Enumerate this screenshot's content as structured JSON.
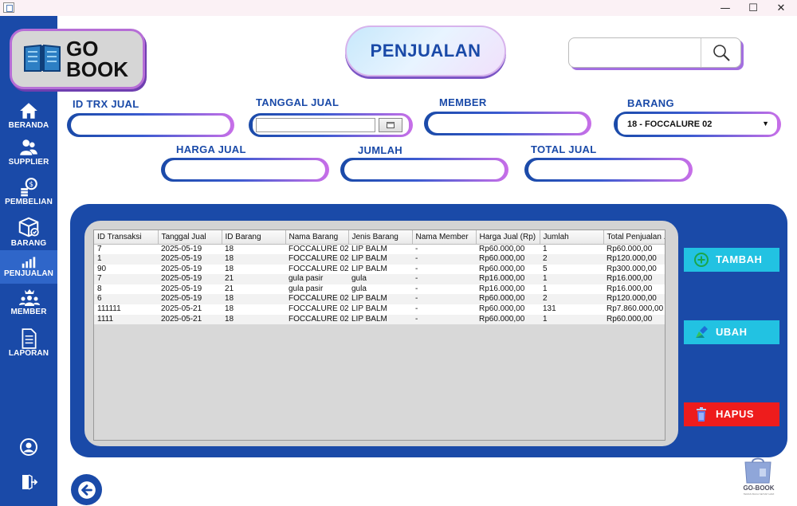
{
  "window": {
    "minimize": "—",
    "maximize": "☐",
    "close": "✕"
  },
  "logo": {
    "line1": "GO",
    "line2": "BOOK"
  },
  "header": {
    "title": "PENJUALAN"
  },
  "search": {
    "value": "",
    "placeholder": ""
  },
  "sidebar": {
    "items": [
      {
        "label": "BERANDA",
        "icon": "home-icon"
      },
      {
        "label": "SUPPLIER",
        "icon": "users-icon"
      },
      {
        "label": "PEMBELIAN",
        "icon": "money-icon"
      },
      {
        "label": "BARANG",
        "icon": "box-icon"
      },
      {
        "label": "PENJUALAN",
        "icon": "bar-chart-icon",
        "active": true
      },
      {
        "label": "MEMBER",
        "icon": "members-icon"
      },
      {
        "label": "LAPORAN",
        "icon": "document-icon"
      }
    ],
    "bottom": [
      {
        "icon": "user-profile-icon"
      },
      {
        "icon": "logout-icon"
      }
    ]
  },
  "form": {
    "id_trx_label": "ID TRX JUAL",
    "id_trx_value": "",
    "tanggal_label": "TANGGAL JUAL",
    "tanggal_value": "",
    "member_label": "MEMBER",
    "member_value": "",
    "barang_label": "BARANG",
    "barang_value": "18 - FOCCALURE 02",
    "harga_label": "HARGA JUAL",
    "harga_value": "",
    "jumlah_label": "JUMLAH",
    "jumlah_value": "",
    "total_label": "TOTAL JUAL",
    "total_value": ""
  },
  "table": {
    "columns": [
      "ID Transaksi",
      "Tanggal Jual",
      "ID Barang",
      "Nama Barang",
      "Jenis Barang",
      "Nama Member",
      "Harga Jual (Rp)",
      "Jumlah",
      "Total Penjualan ..."
    ],
    "rows": [
      [
        "7",
        "2025-05-19",
        "18",
        "FOCCALURE 02",
        "LIP BALM",
        "-",
        "Rp60.000,00",
        "1",
        "Rp60.000,00"
      ],
      [
        "1",
        "2025-05-19",
        "18",
        "FOCCALURE 02",
        "LIP BALM",
        "-",
        "Rp60.000,00",
        "2",
        "Rp120.000,00"
      ],
      [
        "90",
        "2025-05-19",
        "18",
        "FOCCALURE 02",
        "LIP BALM",
        "-",
        "Rp60.000,00",
        "5",
        "Rp300.000,00"
      ],
      [
        "7",
        "2025-05-19",
        "21",
        "gula pasir",
        "gula",
        "-",
        "Rp16.000,00",
        "1",
        "Rp16.000,00"
      ],
      [
        "8",
        "2025-05-19",
        "21",
        "gula pasir",
        "gula",
        "-",
        "Rp16.000,00",
        "1",
        "Rp16.000,00"
      ],
      [
        "6",
        "2025-05-19",
        "18",
        "FOCCALURE 02",
        "LIP BALM",
        "-",
        "Rp60.000,00",
        "2",
        "Rp120.000,00"
      ],
      [
        "111111",
        "2025-05-21",
        "18",
        "FOCCALURE 02",
        "LIP BALM",
        "-",
        "Rp60.000,00",
        "131",
        "Rp7.860.000,00"
      ],
      [
        "1111",
        "2025-05-21",
        "18",
        "FOCCALURE 02",
        "LIP BALM",
        "-",
        "Rp60.000,00",
        "1",
        "Rp60.000,00"
      ]
    ]
  },
  "actions": {
    "add": "TAMBAH",
    "edit": "UBAH",
    "delete": "HAPUS"
  },
  "corner_logo": {
    "text": "GO-BOOK",
    "sub": "TEMAN BACA SETIAP HARI"
  },
  "colors": {
    "primary": "#1a4aa8",
    "accent": "#c86fe8",
    "button_cyan": "#22c2e2",
    "button_red": "#ee1c1c"
  }
}
